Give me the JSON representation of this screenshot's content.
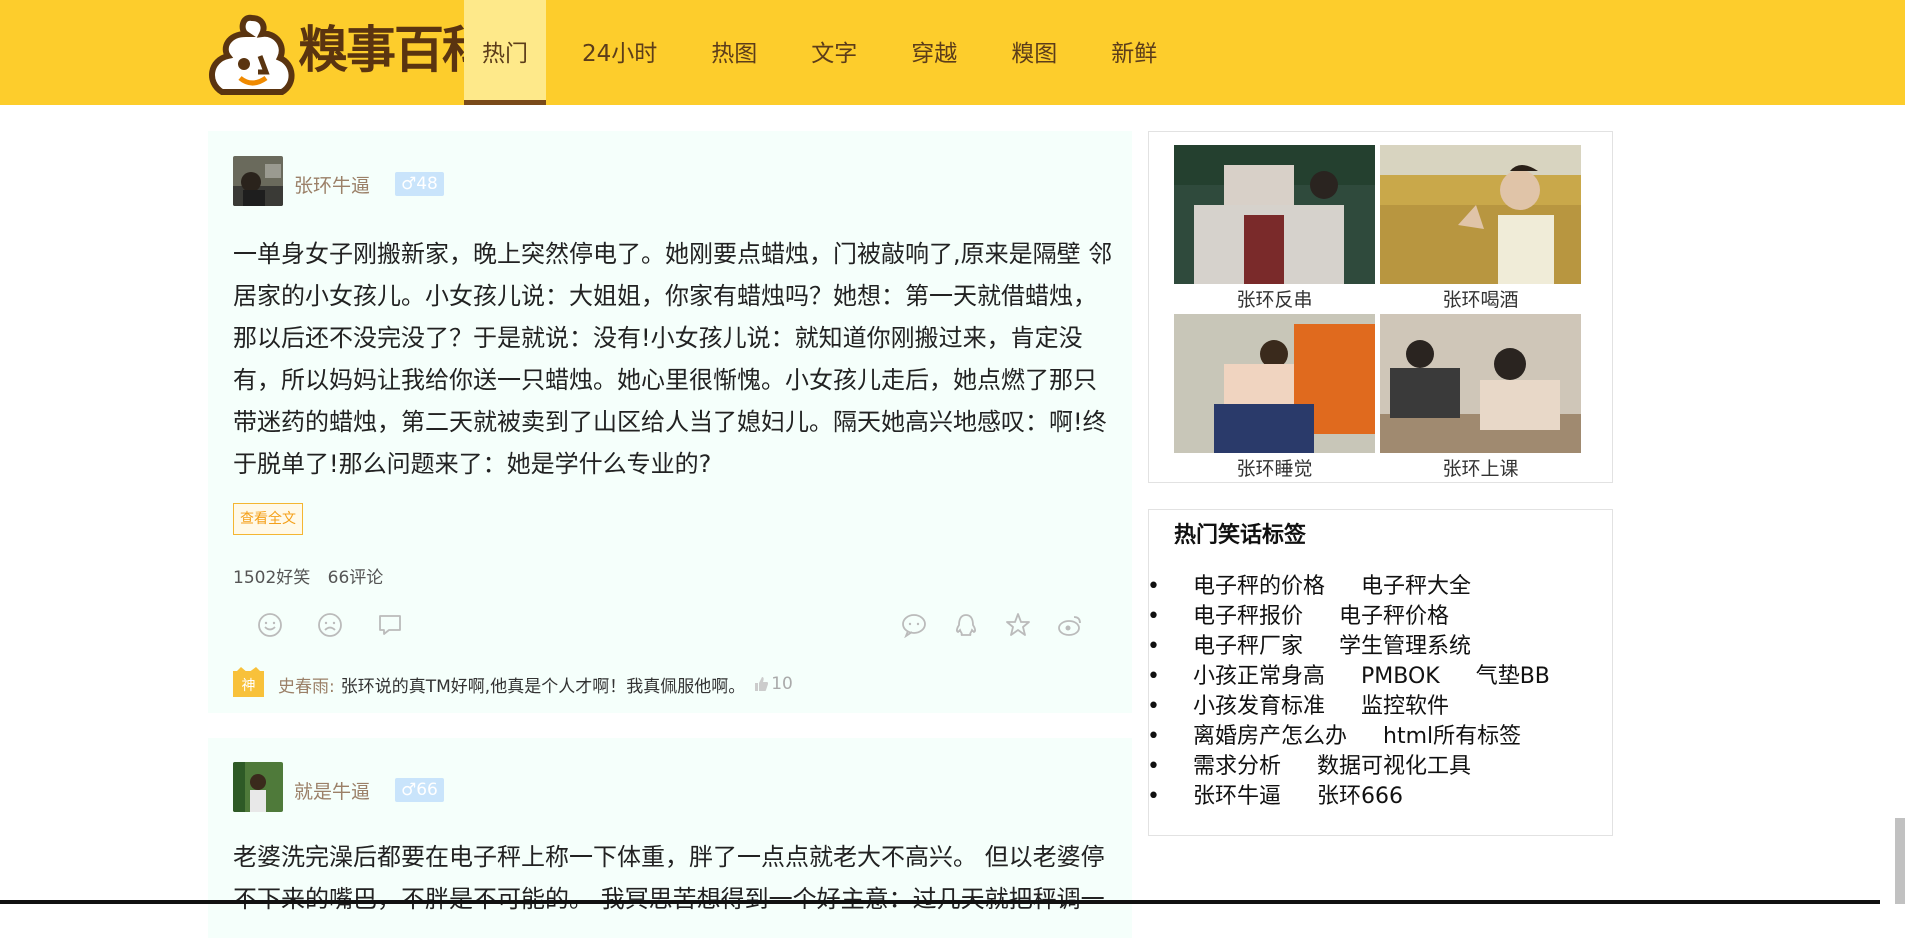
{
  "header": {
    "logo_text": "糗事百科",
    "nav": [
      "热门",
      "24小时",
      "热图",
      "文字",
      "穿越",
      "糗图",
      "新鲜"
    ],
    "active_index": 0
  },
  "posts": [
    {
      "user": "张环牛逼",
      "age": "♂48",
      "content": "一单身女子刚搬新家，晚上突然停电了。她刚要点蜡烛，门被敲响了,原来是隔壁 邻居家的小女孩儿。小女孩儿说：大姐姐，你家有蜡烛吗？她想：第一天就借蜡烛，那以后还不没完没了？于是就说：没有!小女孩儿说：就知道你刚搬过来，肯定没有，所以妈妈让我给你送一只蜡烛。她心里很惭愧。小女孩儿走后，她点燃了那只带迷药的蜡烛，第二天就被卖到了山区给人当了媳妇儿。隔天她高兴地感叹：啊!终于脱单了!那么问题来了：她是学什么专业的?",
      "read_more": "查看全文",
      "funny": "1502好笑",
      "comments": "66评论",
      "god_comment": {
        "tag": "神",
        "user": "史春雨:",
        "text": "张环说的真TM好啊,他真是个人才啊！我真佩服他啊。",
        "likes": "10"
      }
    },
    {
      "user": "就是牛逼",
      "age": "♂66",
      "content": "老婆洗完澡后都要在电子秤上称一下体重，胖了一点点就老大不高兴。 但以老婆停不下来的嘴巴，不胖是不可能的。 我冥思苦想得到一个好主意：过几天就把秤调一"
    }
  ],
  "sidebar": {
    "photos": [
      {
        "caption": "张环反串"
      },
      {
        "caption": "张环喝酒"
      },
      {
        "caption": "张环睡觉"
      },
      {
        "caption": "张环上课"
      }
    ],
    "tags_title": "热门笑话标签",
    "tag_rows": [
      [
        "电子秤的价格",
        "电子秤大全"
      ],
      [
        "电子秤报价",
        "电子秤价格"
      ],
      [
        "电子秤厂家",
        "学生管理系统"
      ],
      [
        "小孩正常身高",
        "PMBOK",
        "气垫BB"
      ],
      [
        "小孩发育标准",
        "监控软件"
      ],
      [
        "离婚房产怎么办",
        "html所有标签"
      ],
      [
        "需求分析",
        "数据可视化工具"
      ],
      [
        "张环牛逼",
        "张环666"
      ]
    ]
  },
  "colors": {
    "header": "#fdcd2c",
    "nav_active": "#fee98a",
    "card_bg": "#f5fffb",
    "accent": "#f4a01a"
  }
}
